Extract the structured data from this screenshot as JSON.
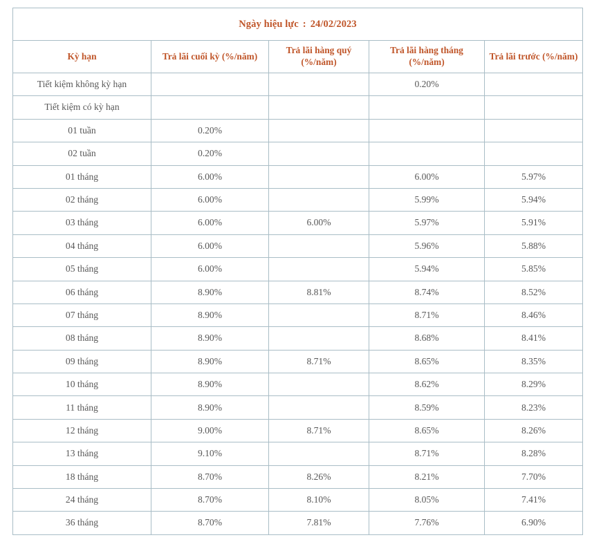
{
  "effective_date": {
    "label": "Ngày hiệu lực",
    "separator": ":",
    "value": "24/02/2023"
  },
  "table": {
    "columns": [
      "Kỳ hạn",
      "Trả lãi cuối  kỳ (%/năm)",
      "Trả lãi hàng quý (%/năm)",
      "Trả lãi hàng tháng (%/năm)",
      "Trả lãi trước (%/năm)"
    ],
    "rows": [
      {
        "term": "Tiết kiệm không kỳ hạn",
        "end_of_term": "",
        "quarterly": "",
        "monthly": "0.20%",
        "upfront": ""
      },
      {
        "term": "Tiết kiệm có kỳ hạn",
        "end_of_term": "",
        "quarterly": "",
        "monthly": "",
        "upfront": ""
      },
      {
        "term": "01 tuần",
        "end_of_term": "0.20%",
        "quarterly": "",
        "monthly": "",
        "upfront": ""
      },
      {
        "term": "02 tuần",
        "end_of_term": "0.20%",
        "quarterly": "",
        "monthly": "",
        "upfront": ""
      },
      {
        "term": "01 tháng",
        "end_of_term": "6.00%",
        "quarterly": "",
        "monthly": "6.00%",
        "upfront": "5.97%"
      },
      {
        "term": "02 tháng",
        "end_of_term": "6.00%",
        "quarterly": "",
        "monthly": "5.99%",
        "upfront": "5.94%"
      },
      {
        "term": "03 tháng",
        "end_of_term": "6.00%",
        "quarterly": "6.00%",
        "monthly": "5.97%",
        "upfront": "5.91%"
      },
      {
        "term": "04 tháng",
        "end_of_term": "6.00%",
        "quarterly": "",
        "monthly": "5.96%",
        "upfront": "5.88%"
      },
      {
        "term": "05 tháng",
        "end_of_term": "6.00%",
        "quarterly": "",
        "monthly": "5.94%",
        "upfront": "5.85%"
      },
      {
        "term": "06 tháng",
        "end_of_term": "8.90%",
        "quarterly": "8.81%",
        "monthly": "8.74%",
        "upfront": "8.52%"
      },
      {
        "term": "07 tháng",
        "end_of_term": "8.90%",
        "quarterly": "",
        "monthly": "8.71%",
        "upfront": "8.46%"
      },
      {
        "term": "08 tháng",
        "end_of_term": "8.90%",
        "quarterly": "",
        "monthly": "8.68%",
        "upfront": "8.41%"
      },
      {
        "term": "09 tháng",
        "end_of_term": "8.90%",
        "quarterly": "8.71%",
        "monthly": "8.65%",
        "upfront": "8.35%"
      },
      {
        "term": "10 tháng",
        "end_of_term": "8.90%",
        "quarterly": "",
        "monthly": "8.62%",
        "upfront": "8.29%"
      },
      {
        "term": "11 tháng",
        "end_of_term": "8.90%",
        "quarterly": "",
        "monthly": "8.59%",
        "upfront": "8.23%"
      },
      {
        "term": "12 tháng",
        "end_of_term": "9.00%",
        "quarterly": "8.71%",
        "monthly": "8.65%",
        "upfront": "8.26%"
      },
      {
        "term": "13 tháng",
        "end_of_term": "9.10%",
        "quarterly": "",
        "monthly": "8.71%",
        "upfront": "8.28%"
      },
      {
        "term": "18 tháng",
        "end_of_term": "8.70%",
        "quarterly": "8.26%",
        "monthly": "8.21%",
        "upfront": "7.70%"
      },
      {
        "term": "24 tháng",
        "end_of_term": "8.70%",
        "quarterly": "8.10%",
        "monthly": "8.05%",
        "upfront": "7.41%"
      },
      {
        "term": "36 tháng",
        "end_of_term": "8.70%",
        "quarterly": "7.81%",
        "monthly": "7.76%",
        "upfront": "6.90%"
      }
    ]
  },
  "colors": {
    "accent": "#c0562a",
    "border": "#a9bdc6",
    "body_text": "#585858"
  }
}
